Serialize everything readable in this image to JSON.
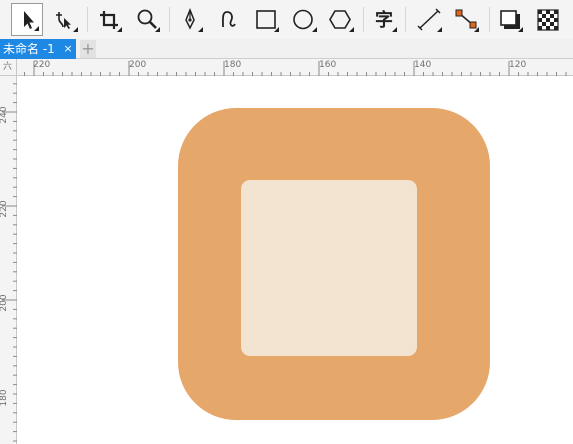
{
  "toolbar": {
    "tools": [
      {
        "icon": "select-arrow-icon",
        "active": true
      },
      {
        "icon": "node-edit-icon"
      },
      {
        "icon": "crop-icon"
      },
      {
        "icon": "zoom-icon"
      },
      {
        "icon": "pen-icon"
      },
      {
        "icon": "curve-icon"
      },
      {
        "icon": "rectangle-icon"
      },
      {
        "icon": "ellipse-icon"
      },
      {
        "icon": "polygon-icon"
      },
      {
        "icon": "text-icon",
        "glyph": "字"
      },
      {
        "icon": "line-icon"
      },
      {
        "icon": "connector-icon"
      },
      {
        "icon": "shadow-icon"
      },
      {
        "icon": "transparency-icon"
      }
    ]
  },
  "tabs": [
    {
      "label": "未命名 -1",
      "close": "×"
    }
  ],
  "tab_add": "+",
  "ruler": {
    "corner_label": "六",
    "horizontal_labels": [
      "220",
      "200",
      "180",
      "160",
      "140",
      "120"
    ],
    "vertical_labels": [
      "240",
      "220",
      "200",
      "180"
    ]
  },
  "canvas": {
    "background": "#ffffff",
    "outer_fill": "#e5a76a",
    "inner_fill": "#f2e4d0"
  },
  "colors": {
    "tab_active": "#1e88e5",
    "toolbar_bg": "#f4f4f4",
    "ruler_bg": "#f4f4f4"
  }
}
